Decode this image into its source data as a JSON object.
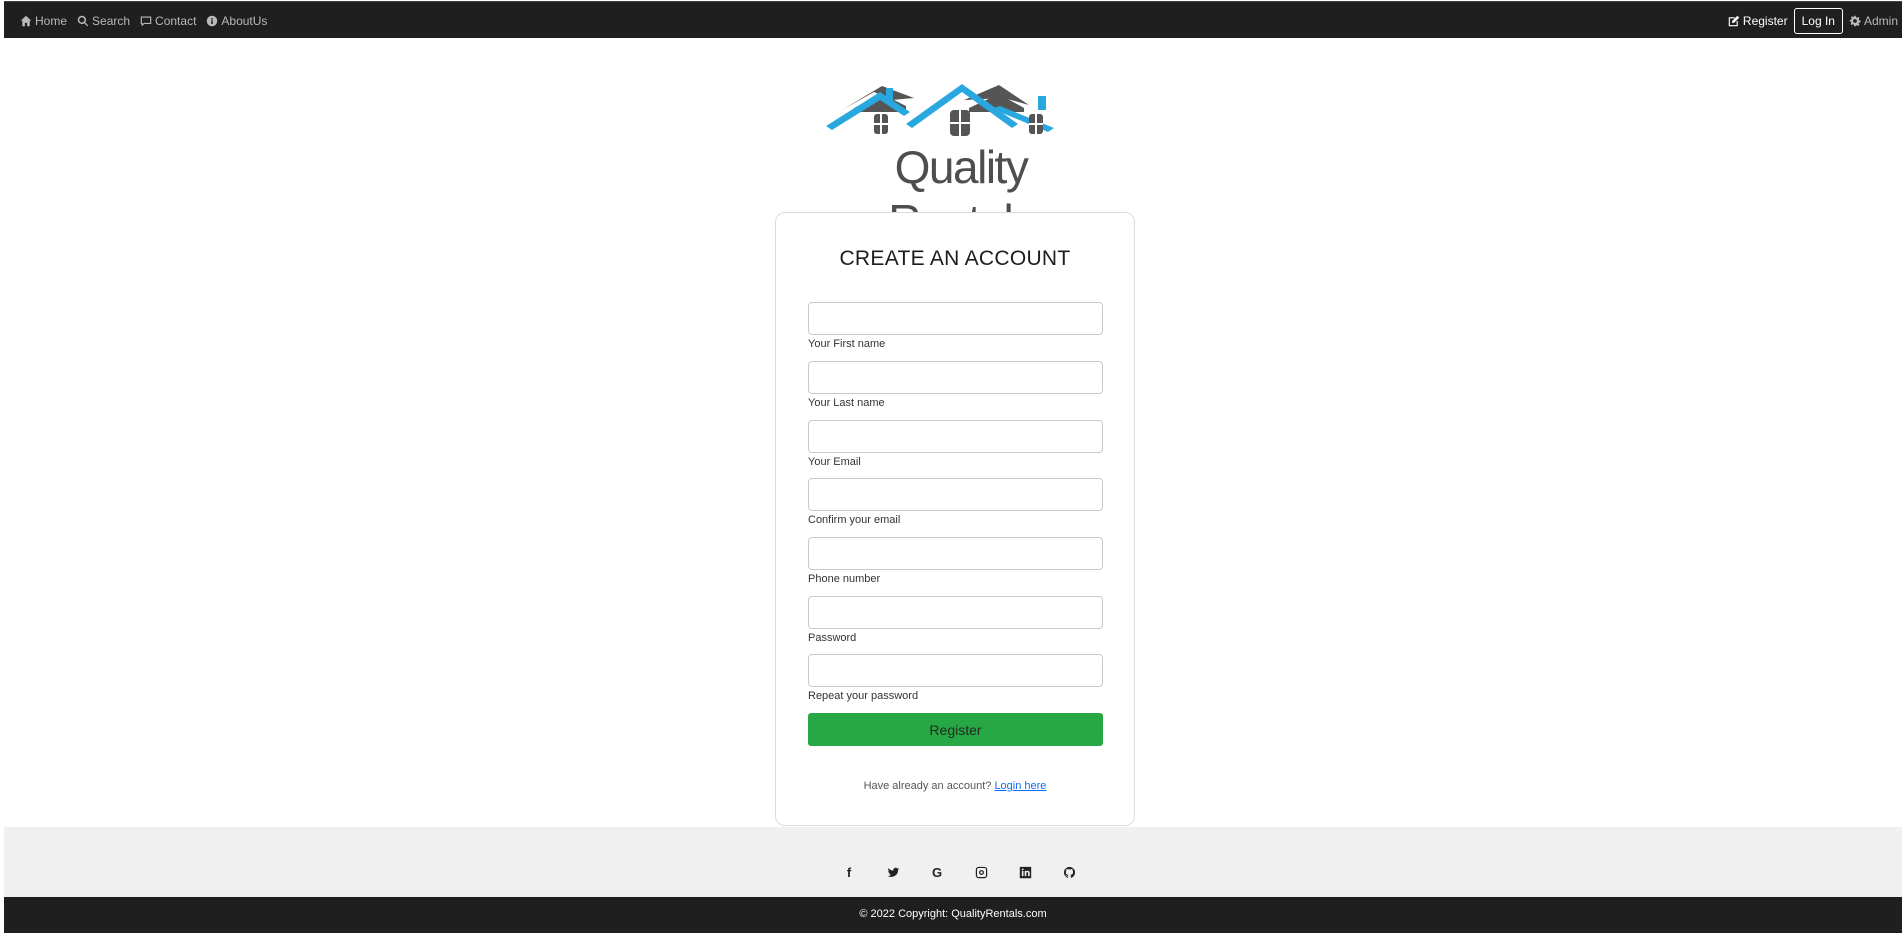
{
  "nav": {
    "home": "Home",
    "search": "Search",
    "contact": "Contact",
    "about": "AboutUs",
    "register": "Register",
    "login": "Log In",
    "admin": "Admin"
  },
  "logo": {
    "text": "Quality Rentals",
    "roof_color": "#29a8e0",
    "gray_roof_color": "#555555"
  },
  "form": {
    "title": "CREATE AN ACCOUNT",
    "fields": [
      {
        "label": "Your First name",
        "value": ""
      },
      {
        "label": "Your Last name",
        "value": ""
      },
      {
        "label": "Your Email",
        "value": ""
      },
      {
        "label": "Confirm your email",
        "value": ""
      },
      {
        "label": "Phone number",
        "value": ""
      },
      {
        "label": "Password",
        "value": ""
      },
      {
        "label": "Repeat your password",
        "value": ""
      }
    ],
    "submit": "Register",
    "have_account": "Have already an account?",
    "login_link": "Login here"
  },
  "social": [
    "facebook-icon",
    "twitter-icon",
    "google-icon",
    "instagram-icon",
    "linkedin-icon",
    "github-icon"
  ],
  "footer": {
    "copyright": "© 2022 Copyright: QualityRentals.com"
  },
  "colors": {
    "navbar": "#1f1f1f",
    "register_button": "#28a745",
    "social_bar": "#f0f0f0"
  }
}
